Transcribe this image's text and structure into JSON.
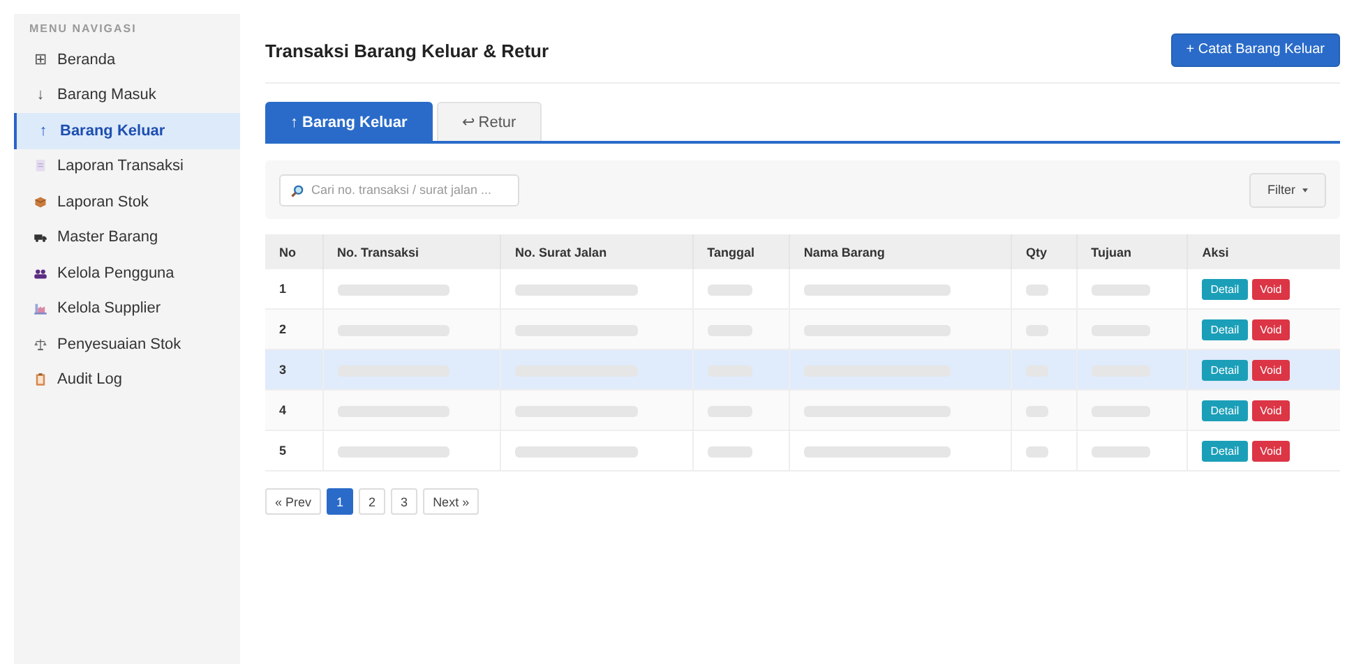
{
  "sidebar": {
    "heading": "MENU NAVIGASI",
    "items": [
      {
        "label": "Beranda",
        "glyph": "⊞",
        "selected": false
      },
      {
        "label": "Barang Masuk",
        "glyph": "↓",
        "selected": false
      },
      {
        "label": "Barang Keluar",
        "glyph": "↑",
        "selected": true
      },
      {
        "label": "Laporan Transaksi",
        "selected": false
      },
      {
        "label": "Laporan Stok",
        "selected": false
      },
      {
        "label": "Master Barang",
        "selected": false
      },
      {
        "label": "Kelola Pengguna",
        "selected": false
      },
      {
        "label": "Kelola Supplier",
        "selected": false
      },
      {
        "label": "Penyesuaian Stok",
        "selected": false
      },
      {
        "label": "Audit Log",
        "selected": false
      }
    ]
  },
  "page": {
    "title": "Transaksi Barang Keluar & Retur",
    "primary_button": "+ Catat Barang Keluar"
  },
  "tabs": [
    {
      "label": "↑ Barang Keluar",
      "selected": true
    },
    {
      "label": "↩ Retur",
      "selected": false
    }
  ],
  "search": {
    "placeholder": "Cari no. transaksi / surat jalan ..."
  },
  "filter_button": "Filter",
  "table": {
    "columns": [
      "No",
      "No. Transaksi",
      "No. Surat Jalan",
      "Tanggal",
      "Nama Barang",
      "Qty",
      "Tujuan",
      "Aksi"
    ],
    "rows": [
      {
        "no": "1",
        "selected": false,
        "actions": [
          {
            "kind": "detail",
            "label": "Detail"
          },
          {
            "kind": "void",
            "label": "Void"
          }
        ]
      },
      {
        "no": "2",
        "selected": false,
        "actions": [
          {
            "kind": "detail",
            "label": "Detail"
          },
          {
            "kind": "void",
            "label": "Void"
          }
        ]
      },
      {
        "no": "3",
        "selected": true,
        "actions": [
          {
            "kind": "detail",
            "label": "Detail"
          },
          {
            "kind": "void",
            "label": "Void"
          }
        ]
      },
      {
        "no": "4",
        "selected": false,
        "actions": [
          {
            "kind": "detail",
            "label": "Detail"
          },
          {
            "kind": "void",
            "label": "Void"
          }
        ]
      },
      {
        "no": "5",
        "selected": false,
        "actions": [
          {
            "kind": "detail",
            "label": "Detail"
          },
          {
            "kind": "void",
            "label": "Void"
          }
        ]
      }
    ]
  },
  "pagination": [
    {
      "label": "« Prev",
      "selected": false
    },
    {
      "label": "1",
      "selected": true
    },
    {
      "label": "2",
      "selected": false
    },
    {
      "label": "3",
      "selected": false
    },
    {
      "label": "Next »",
      "selected": false
    }
  ]
}
